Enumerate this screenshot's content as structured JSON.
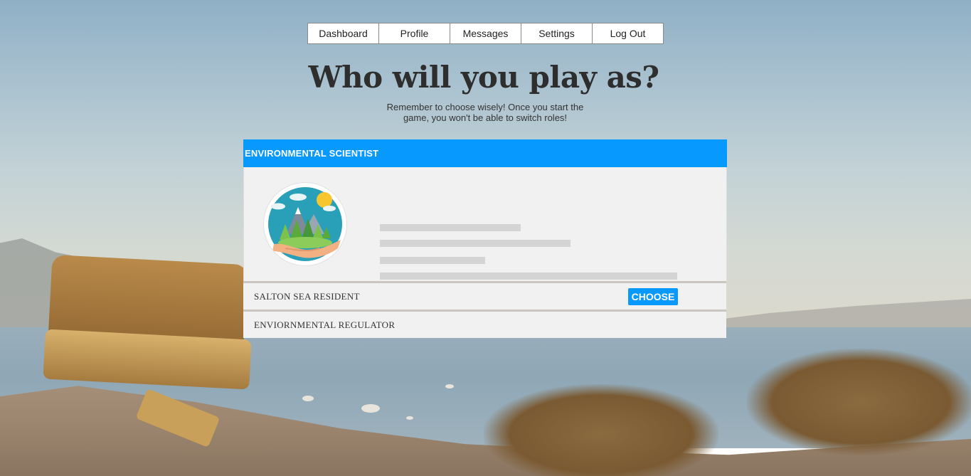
{
  "nav": {
    "items": [
      "Dashboard",
      "Profile",
      "Messages",
      "Settings",
      "Log Out"
    ]
  },
  "heading": {
    "title": "Who will you play as?",
    "subtitle": "Remember to choose wisely! Once you start the game, you won't be able to switch roles!"
  },
  "roles": {
    "active": {
      "name": "ENVIRONMENTAL SCIENTIST",
      "icon": "nature-in-hand-icon",
      "choose_label": "CHOOSE"
    },
    "others": [
      "SALTON SEA RESIDENT",
      "ENVIORNMENTAL REGULATOR"
    ]
  },
  "colors": {
    "accent": "#0899ff",
    "panel_bg": "#f1f1f1",
    "placeholder": "#d4d4d4"
  }
}
